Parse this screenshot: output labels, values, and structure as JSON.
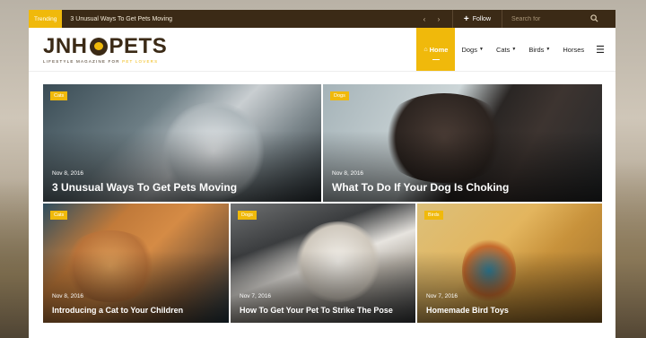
{
  "topbar": {
    "trending_label": "Trending",
    "trending_headline": "3 Unusual Ways To Get Pets Moving",
    "prev_arrow": "‹",
    "next_arrow": "›",
    "follow_label": "Follow",
    "search_placeholder": "Search for"
  },
  "logo": {
    "text_left": "JNH",
    "text_right": "PETS",
    "tagline_main": "LIFESTYLE MAGAZINE FOR ",
    "tagline_highlight": "PET LOVERS"
  },
  "nav": {
    "items": [
      {
        "label": "Home",
        "active": true
      },
      {
        "label": "Dogs",
        "dropdown": true
      },
      {
        "label": "Cats",
        "dropdown": true
      },
      {
        "label": "Birds",
        "dropdown": true
      },
      {
        "label": "Horses"
      }
    ],
    "menu_icon": "hamburger-icon"
  },
  "posts": [
    {
      "category": "Cats",
      "date": "Nov 8, 2016",
      "title": "3 Unusual Ways To Get Pets Moving"
    },
    {
      "category": "Dogs",
      "date": "Nov 8, 2016",
      "title": "What To Do If Your Dog Is Choking"
    },
    {
      "category": "Cats",
      "date": "Nov 8, 2016",
      "title": "Introducing a Cat to Your Children"
    },
    {
      "category": "Dogs",
      "date": "Nov 7, 2016",
      "title": "How To Get Your Pet To Strike The Pose"
    },
    {
      "category": "Birds",
      "date": "Nov 7, 2016",
      "title": "Homemade Bird Toys"
    }
  ],
  "colors": {
    "accent": "#f0b90b",
    "topbar_bg": "#3b2a16"
  }
}
